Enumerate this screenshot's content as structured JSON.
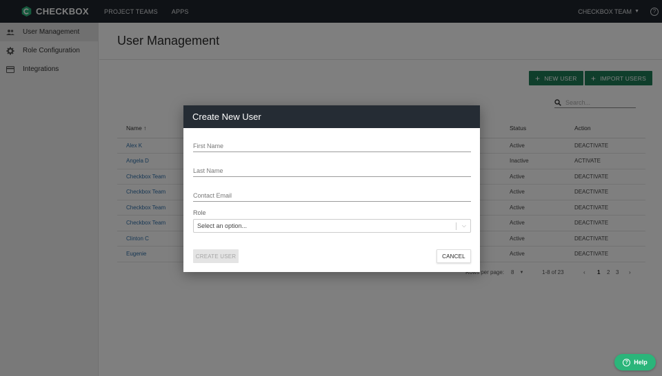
{
  "app": {
    "brand": "CHECKBOX",
    "brand_color": "#2bb57a",
    "nav": [
      "PROJECT TEAMS",
      "APPS"
    ],
    "team_menu": "CHECKBOX TEAM",
    "help_glyph": "?"
  },
  "sidebar": {
    "items": [
      {
        "label": "User Management",
        "icon": "users-icon",
        "active": true
      },
      {
        "label": "Role Configuration",
        "icon": "gear-icon",
        "active": false
      },
      {
        "label": "Integrations",
        "icon": "card-icon",
        "active": false
      }
    ]
  },
  "main": {
    "title": "User Management",
    "new_user_label": "NEW USER",
    "import_users_label": "IMPORT USERS",
    "search_placeholder": "Search...",
    "table": {
      "headers": {
        "name": "Name",
        "sort_arrow": "↑",
        "status": "Status",
        "action": "Action"
      },
      "rows": [
        {
          "name": "Alex K",
          "status": "Active",
          "action": "DEACTIVATE"
        },
        {
          "name": "Angela D",
          "status": "Inactive",
          "action": "ACTIVATE"
        },
        {
          "name": "Checkbox Team",
          "status": "Active",
          "action": "DEACTIVATE"
        },
        {
          "name": "Checkbox Team",
          "status": "Active",
          "action": "DEACTIVATE"
        },
        {
          "name": "Checkbox Team",
          "status": "Active",
          "action": "DEACTIVATE"
        },
        {
          "name": "Checkbox Team",
          "status": "Active",
          "action": "DEACTIVATE"
        },
        {
          "name": "Clinton C",
          "status": "Active",
          "action": "DEACTIVATE"
        },
        {
          "name": "Eugenie",
          "status": "Active",
          "action": "DEACTIVATE"
        }
      ]
    },
    "pagination": {
      "rows_per_page_label": "Rows per page:",
      "rows_per_page": "8",
      "range": "1-8 of 23",
      "pages": [
        "1",
        "2",
        "3"
      ]
    }
  },
  "modal": {
    "title": "Create New User",
    "first_name_placeholder": "First Name",
    "last_name_placeholder": "Last Name",
    "email_placeholder": "Contact Email",
    "role_label": "Role",
    "role_placeholder": "Select an option...",
    "create_label": "CREATE USER",
    "cancel_label": "CANCEL"
  },
  "help_button": {
    "label": "Help"
  }
}
